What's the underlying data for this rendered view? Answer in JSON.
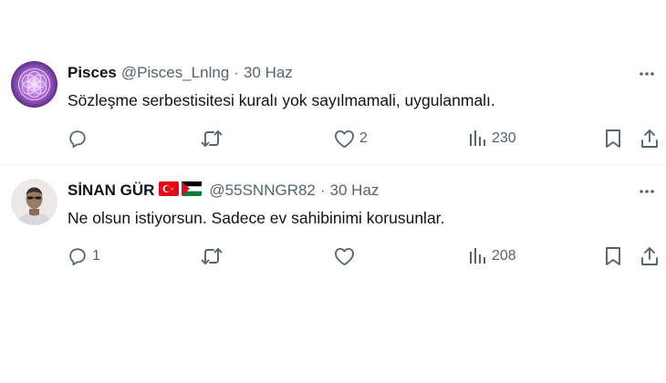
{
  "tweets": [
    {
      "name": "Pisces",
      "handle": "@Pisces_Lnlng",
      "separator": "·",
      "date": "30 Haz",
      "text": "Sözleşme serbestisitesi kuralı yok sayılmamali, uygulanmalı.",
      "replies": "",
      "retweets": "",
      "likes": "2",
      "views": "230",
      "avatar": "purple-mandala"
    },
    {
      "name": "SİNAN GÜR",
      "flags": [
        "turkey-flag",
        "palestine-flag"
      ],
      "handle": "@55SNNGR82",
      "separator": "·",
      "date": "30 Haz",
      "text": "Ne olsun istiyorsun. Sadece ev sahibinimi korusunlar.",
      "replies": "1",
      "retweets": "",
      "likes": "",
      "views": "208",
      "avatar": "man-photo"
    }
  ],
  "icons": [
    "more-icon",
    "reply-icon",
    "retweet-icon",
    "like-icon",
    "views-icon",
    "bookmark-icon",
    "share-icon"
  ],
  "colors": {
    "text": "#0f1419",
    "secondary": "#536471",
    "divider": "#eff3f4"
  }
}
